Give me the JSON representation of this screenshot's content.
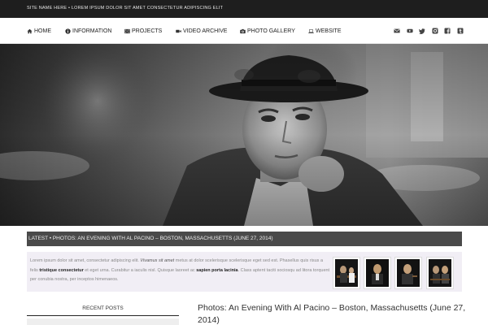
{
  "topbar": {
    "text": "SITE NAME HERE • LOREM IPSUM DOLOR SIT AMET CONSECTETUR ADIPISCING ELIT"
  },
  "nav": {
    "items": [
      {
        "label": "HOME",
        "icon": "home-icon"
      },
      {
        "label": "INFORMATION",
        "icon": "info-icon"
      },
      {
        "label": "PROJECTS",
        "icon": "film-icon"
      },
      {
        "label": "VIDEO ARCHIVE",
        "icon": "video-camera-icon"
      },
      {
        "label": "PHOTO GALLERY",
        "icon": "camera-icon"
      },
      {
        "label": "WEBSITE",
        "icon": "laptop-icon"
      }
    ],
    "social": [
      "email-icon",
      "youtube-icon",
      "twitter-icon",
      "instagram-icon",
      "facebook-icon",
      "tumblr-icon"
    ]
  },
  "latest": {
    "text": "LATEST • PHOTOS: AN EVENING WITH AL PACINO – BOSTON, MASSACHUSETTS (JUNE 27, 2014)"
  },
  "lorem": {
    "p1": "Lorem ipsum dolor sit amet, consectetur adipiscing elit. ",
    "p2": "Vivamus sit amet",
    "p3": " metus at dolor scelerisque scelerisque eget sed est. Phasellus quis risus a felis ",
    "p4": "tristique consectetur",
    "p5": " et eget urna. Curabitur a iaculis nisl. Quisque laoreet ac ",
    "p6": "sapien porta lacinia",
    "p7": ". Class aptent taciti sociosqu ad litora torquent per conubia nostra, per inceptos himenaeos."
  },
  "sidebar": {
    "heading": "RECENT POSTS"
  },
  "post": {
    "title": "Photos: An Evening With Al Pacino – Boston, Massachusetts (June 27, 2014)"
  },
  "colors": {
    "topbar": "#1e1e1e",
    "latest_bar": "#4a4a4a",
    "lorem_bg": "#f1eef5"
  }
}
